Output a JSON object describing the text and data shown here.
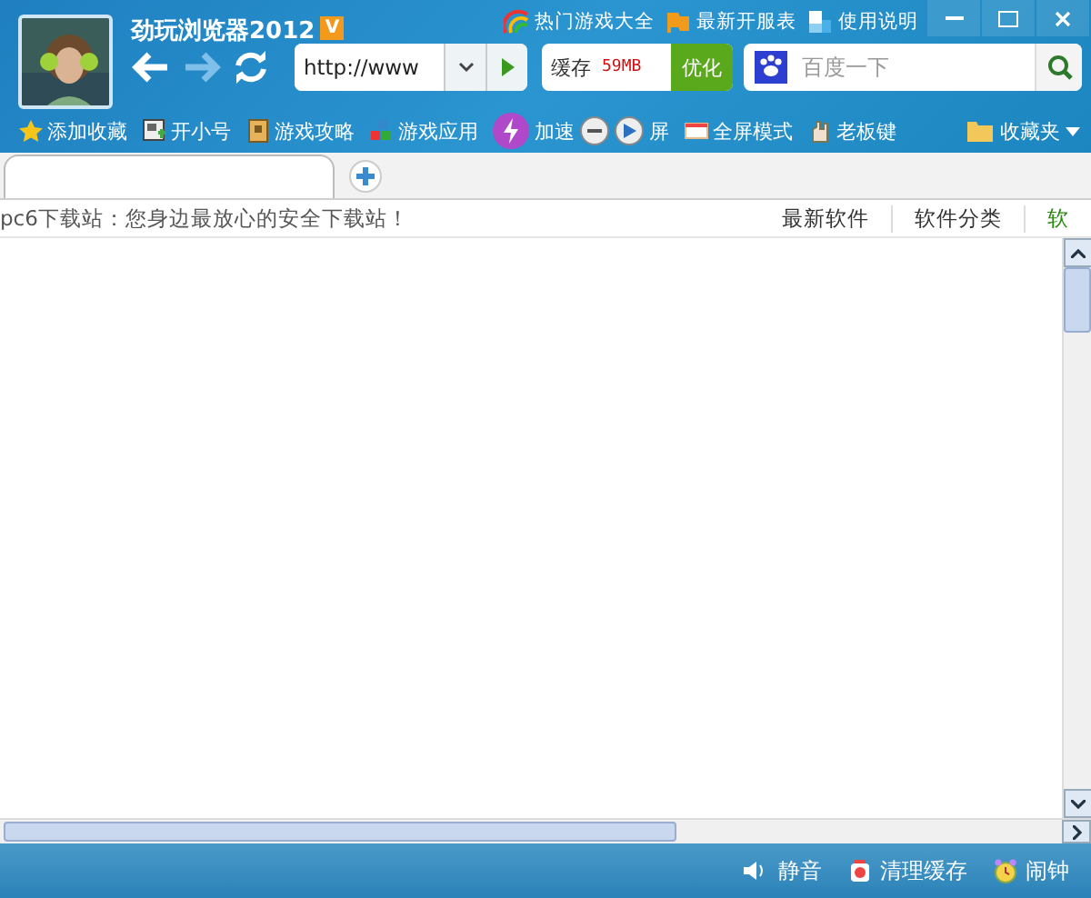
{
  "window": {
    "title": "劲玩浏览器2012",
    "badge": "V"
  },
  "top_links": [
    {
      "label": "热门游戏大全",
      "kind": "rainbow"
    },
    {
      "label": "最新开服表",
      "kind": "flag"
    },
    {
      "label": "使用说明",
      "kind": "tiles"
    }
  ],
  "address": {
    "value": "http://www"
  },
  "cache": {
    "label": "缓存",
    "size": "59MB",
    "button": "优化"
  },
  "search": {
    "placeholder": "百度一下"
  },
  "bookmarks": [
    {
      "label": "添加收藏",
      "kind": "star"
    },
    {
      "label": "开小号",
      "kind": "window"
    },
    {
      "label": "游戏攻略",
      "kind": "book"
    },
    {
      "label": "游戏应用",
      "kind": "blocks"
    }
  ],
  "floating": {
    "speed": "加速",
    "screen": "屏"
  },
  "bookmarks_right": [
    {
      "label": "全屏模式",
      "kind": "screen"
    },
    {
      "label": "老板键",
      "kind": "hand"
    }
  ],
  "favorites": "收藏夹",
  "tabs": [
    {
      "selected": true
    }
  ],
  "info_bar": {
    "text": "pc6下载站：您身边最放心的安全下载站！",
    "links": [
      {
        "label": "最新软件",
        "color": "#333333"
      },
      {
        "label": "软件分类",
        "color": "#333333"
      },
      {
        "label": "软",
        "color": "#2a8a10"
      }
    ]
  },
  "status_bar": [
    {
      "label": "静音",
      "kind": "speaker"
    },
    {
      "label": "清理缓存",
      "kind": "bin"
    },
    {
      "label": "闹钟",
      "kind": "clock"
    }
  ]
}
